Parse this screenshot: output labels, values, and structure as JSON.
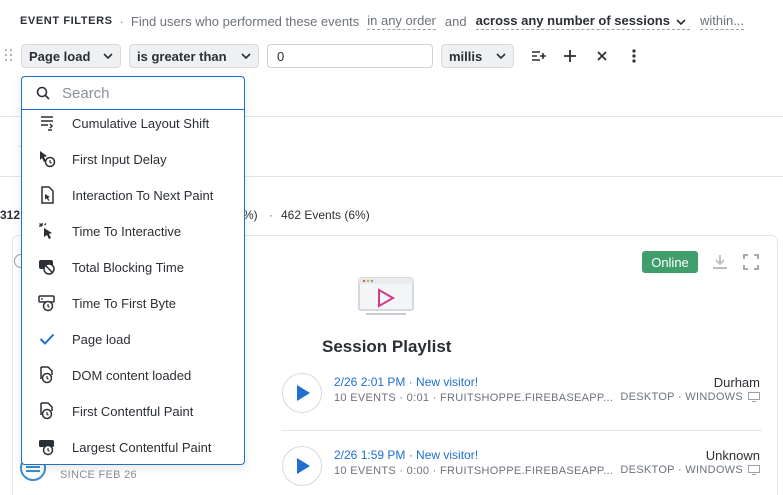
{
  "header": {
    "eyebrow": "EVENT FILTERS",
    "separator": "·",
    "description": "Find users who performed these events",
    "order": "in any order",
    "conjunction": "and",
    "sessions": "across any number of sessions",
    "within": "within..."
  },
  "filter": {
    "event": "Page load",
    "operator": "is greater than",
    "value": "0",
    "unit": "millis"
  },
  "search": {
    "placeholder": "Search",
    "value": ""
  },
  "menu_items": [
    {
      "label": "Cumulative Layout Shift",
      "icon": "layout-shift-icon"
    },
    {
      "label": "First Input Delay",
      "icon": "cursor-timer-icon"
    },
    {
      "label": "Interaction To Next Paint",
      "icon": "document-cursor-icon"
    },
    {
      "label": "Time To Interactive",
      "icon": "click-icon"
    },
    {
      "label": "Total Blocking Time",
      "icon": "blocked-timer-icon"
    },
    {
      "label": "Time To First Byte",
      "icon": "server-timer-icon"
    },
    {
      "label": "Page load",
      "icon": "check-icon",
      "selected": true
    },
    {
      "label": "DOM content loaded",
      "icon": "page-timer-icon"
    },
    {
      "label": "First Contentful Paint",
      "icon": "page-timer-icon"
    },
    {
      "label": "Largest Contentful Paint",
      "icon": "window-timer-icon"
    }
  ],
  "stats": {
    "partial_count": "312 U",
    "partial_pct": "%)",
    "dot": "·",
    "events": "462 Events (6%)"
  },
  "panel": {
    "status": "Online",
    "playlist_title": "Session Playlist"
  },
  "sessions": [
    {
      "when": "2/26 2:01 PM · New visitor!",
      "meta": "10 EVENTS · 0:01 · FRUITSHOPPE.FIREBASEAPP...",
      "city": "Durham",
      "device": "DESKTOP · WINDOWS"
    },
    {
      "when": "2/26 1:59 PM · New visitor!",
      "meta": "10 EVENTS · 0:00 · FRUITSHOPPE.FIREBASEAPP...",
      "city": "Unknown",
      "device": "DESKTOP · WINDOWS"
    }
  ],
  "since": "SINCE FEB 26",
  "colors": {
    "accent": "#1f6fd1",
    "online": "#3f9e6a",
    "play": "#1f6fd1"
  }
}
